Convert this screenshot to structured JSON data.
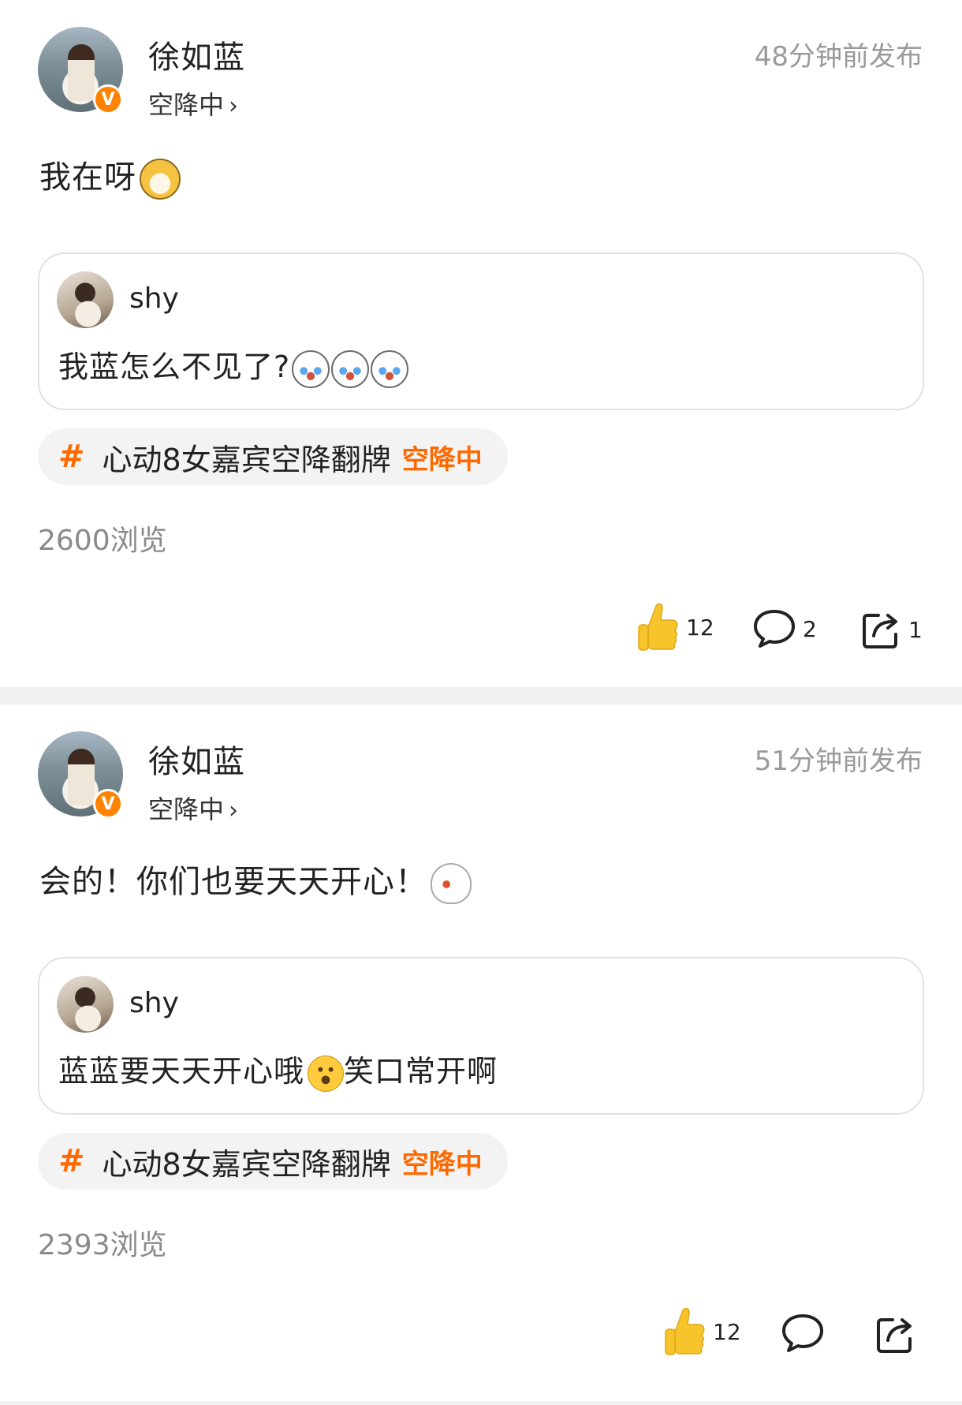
{
  "posts": [
    {
      "username": "徐如蓝",
      "badge": "V",
      "status": "空降中",
      "chevron": "›",
      "time": "48分钟前发布",
      "text": "我在呀",
      "text_emoji": "doge-emoji",
      "quote": {
        "name": "shy",
        "text": "我蓝怎么不见了?",
        "emojis": [
          "crying-emoji",
          "crying-emoji",
          "crying-emoji"
        ]
      },
      "topic": {
        "hash": "#",
        "text": "心动8女嘉宾空降翻牌",
        "tag": "空降中"
      },
      "views": "2600浏览",
      "actions": {
        "likes": "12",
        "comments": "2",
        "shares": "1"
      }
    },
    {
      "username": "徐如蓝",
      "badge": "V",
      "status": "空降中",
      "chevron": "›",
      "time": "51分钟前发布",
      "text": "会的！你们也要天天开心！",
      "text_emoji": "duck-emoji",
      "quote": {
        "name": "shy",
        "text_before": "蓝蓝要天天开心哦",
        "emoji": "smile-emoji",
        "text_after": "笑口常开啊"
      },
      "topic": {
        "hash": "#",
        "text": "心动8女嘉宾空降翻牌",
        "tag": "空降中"
      },
      "views": "2393浏览",
      "actions": {
        "likes": "12",
        "comments": "",
        "shares": ""
      }
    }
  ],
  "colors": {
    "accent": "#ff6a00",
    "verified": "#ff8200",
    "muted": "#9a9a9a",
    "like_yellow": "#f7c52b"
  }
}
